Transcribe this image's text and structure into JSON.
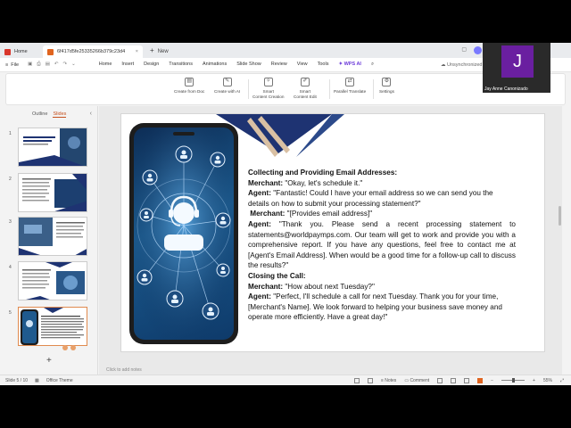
{
  "tabs": {
    "home": "Home",
    "doc": "6f417d5fe25335266b379c23d4",
    "new": "New"
  },
  "menubar": {
    "file": "File",
    "items": [
      "Home",
      "Insert",
      "Design",
      "Transitions",
      "Animations",
      "Slide Show",
      "Review",
      "View",
      "Tools"
    ],
    "wps_ai": "WPS AI",
    "sync": "Unsynchronized"
  },
  "ribbon": {
    "create_doc": "Create from Doc",
    "create_ai": "Create with AI",
    "smart_creation_1": "Smart",
    "smart_creation_2": "Content Creation",
    "smart_edit_1": "Smart",
    "smart_edit_2": "Content Edit",
    "parallel_translate": "Parallel Translate",
    "settings": "Settings"
  },
  "leftpanel": {
    "outline": "Outline",
    "slides": "Slides",
    "numbers": [
      "1",
      "2",
      "3",
      "4",
      "5"
    ]
  },
  "slide": {
    "heading": "Collecting and Providing Email Addresses:",
    "l1_speaker": "Merchant:",
    "l1_text": " \"Okay, let's schedule it.\"",
    "l2_speaker": "Agent:",
    "l2_text": " \"Fantastic! Could I have your email address so we can send you the details on how to submit your processing statement?\"",
    "l3_speaker": "Merchant:",
    "l3_text": " \"[Provides email address]\"",
    "l4_speaker": "Agent:",
    "l4_text": " \"Thank you. Please send a recent processing statement to statements@worldpaymps.com. Our team will get to work and provide you with a comprehensive report. If you have any questions, feel free to contact me at [Agent's Email Address]. When would be a good time for a follow-up call to discuss the results?\"",
    "heading2": "Closing the Call:",
    "l5_speaker": "Merchant:",
    "l5_text": " \"How about next Tuesday?\"",
    "l6_speaker": "Agent:",
    "l6_text": " \"Perfect, I'll schedule a call for next Tuesday. Thank you for your time, [Merchant's Name]. We look forward to helping your business save money and operate more efficiently. Have a great day!\""
  },
  "notes_hint": "Click to add notes",
  "status": {
    "slide_count": "Slide 5 / 10",
    "theme": "Office Theme",
    "notes": "Notes",
    "comment": "Comment",
    "zoom": "55%"
  },
  "webcam": {
    "initial": "J",
    "name": "Jay Anne Canonizado"
  },
  "colors": {
    "accent": "#c6501e",
    "wps_ai": "#6c3bd9",
    "slide_navy": "#1e3372",
    "avatar": "#6a1fa0"
  }
}
